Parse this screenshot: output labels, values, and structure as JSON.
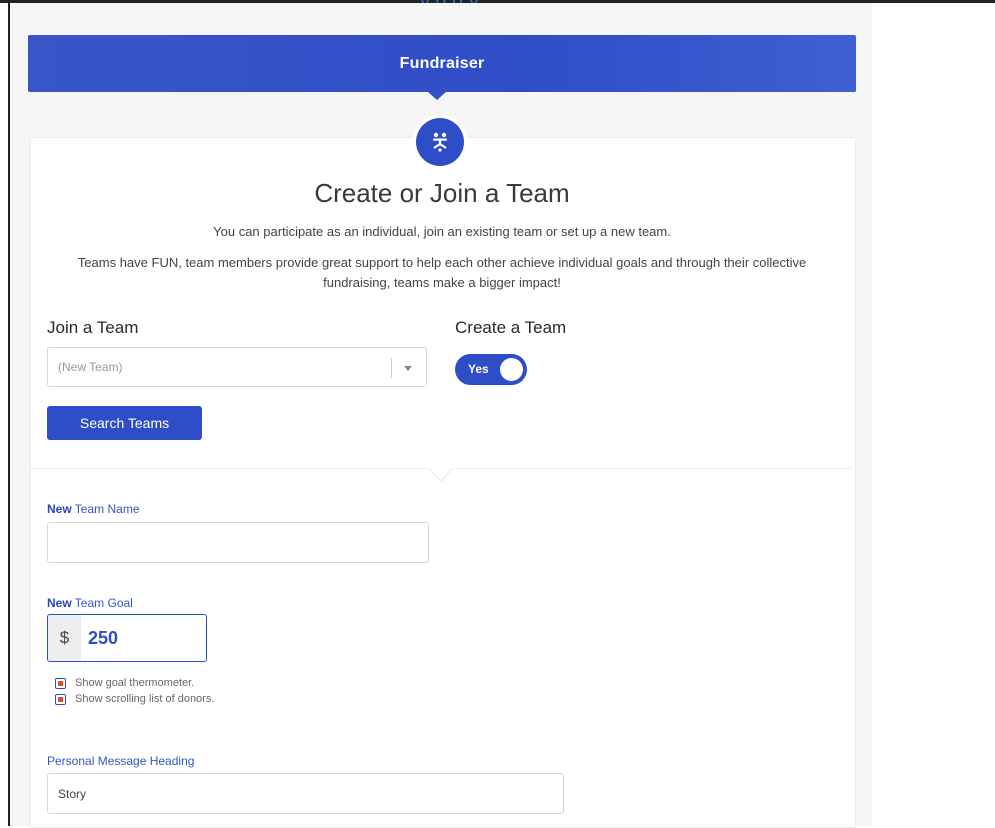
{
  "top_link": {
    "text": "…y                    g                     g   y"
  },
  "banner": {
    "title": "Fundraiser"
  },
  "section": {
    "heading": "Create or Join a Team",
    "intro_line1": "You can participate as an individual, join an existing team or set up a new team.",
    "intro_line2": "Teams have FUN, team members provide great support to help each other achieve individual goals and through their collective fundraising, teams make a bigger impact!"
  },
  "join": {
    "title": "Join a Team",
    "select_value": "(New Team)",
    "search_button": "Search Teams"
  },
  "create": {
    "title": "Create a Team",
    "toggle_label": "Yes",
    "toggle_on": true
  },
  "team_name": {
    "label_prefix": "New",
    "label_rest": " Team Name",
    "value": ""
  },
  "team_goal": {
    "label_prefix": "New",
    "label_rest": " Team Goal",
    "currency": "$",
    "value": "250"
  },
  "options": {
    "show_thermometer": "Show goal thermometer.",
    "show_donors": "Show scrolling list of donors."
  },
  "message": {
    "heading_label": "Personal Message Heading",
    "heading_value": "Story"
  },
  "colors": {
    "primary": "#2f4dc7",
    "checkbox_fill": "#d5541f"
  }
}
